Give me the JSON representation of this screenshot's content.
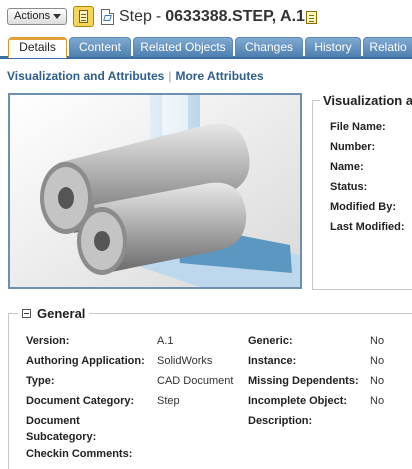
{
  "header": {
    "actions_label": "Actions",
    "title_type": "Step",
    "title_separator": "-",
    "title_number": "0633388.STEP, A.1"
  },
  "tabs": [
    {
      "label": "Details",
      "active": true
    },
    {
      "label": "Content",
      "active": false
    },
    {
      "label": "Related Objects",
      "active": false
    },
    {
      "label": "Changes",
      "active": false
    },
    {
      "label": "History",
      "active": false
    },
    {
      "label": "Relatio",
      "active": false
    }
  ],
  "subnav": {
    "link1": "Visualization and Attributes",
    "separator": "|",
    "link2": "More Attributes"
  },
  "visualization": {
    "title": "Visualization a",
    "labels": [
      "File Name:",
      "Number:",
      "Name:",
      "Status:",
      "Modified By:",
      "Last Modified:"
    ]
  },
  "general": {
    "title": "General",
    "left": [
      {
        "label": "Version:",
        "value": "A.1"
      },
      {
        "label": "Authoring Application:",
        "value": "SolidWorks"
      },
      {
        "label": "Type:",
        "value": "CAD Document"
      },
      {
        "label": "Document Category:",
        "value": "Step"
      },
      {
        "label": "Document",
        "value": ""
      },
      {
        "label": "Subcategory:",
        "value": ""
      },
      {
        "label": "Checkin Comments:",
        "value": ""
      }
    ],
    "right": [
      {
        "label": "Generic:",
        "value": "No"
      },
      {
        "label": "Instance:",
        "value": "No"
      },
      {
        "label": "Missing Dependents:",
        "value": "No"
      },
      {
        "label": "Incomplete Object:",
        "value": "No"
      },
      {
        "label": "Description:",
        "value": ""
      }
    ]
  }
}
